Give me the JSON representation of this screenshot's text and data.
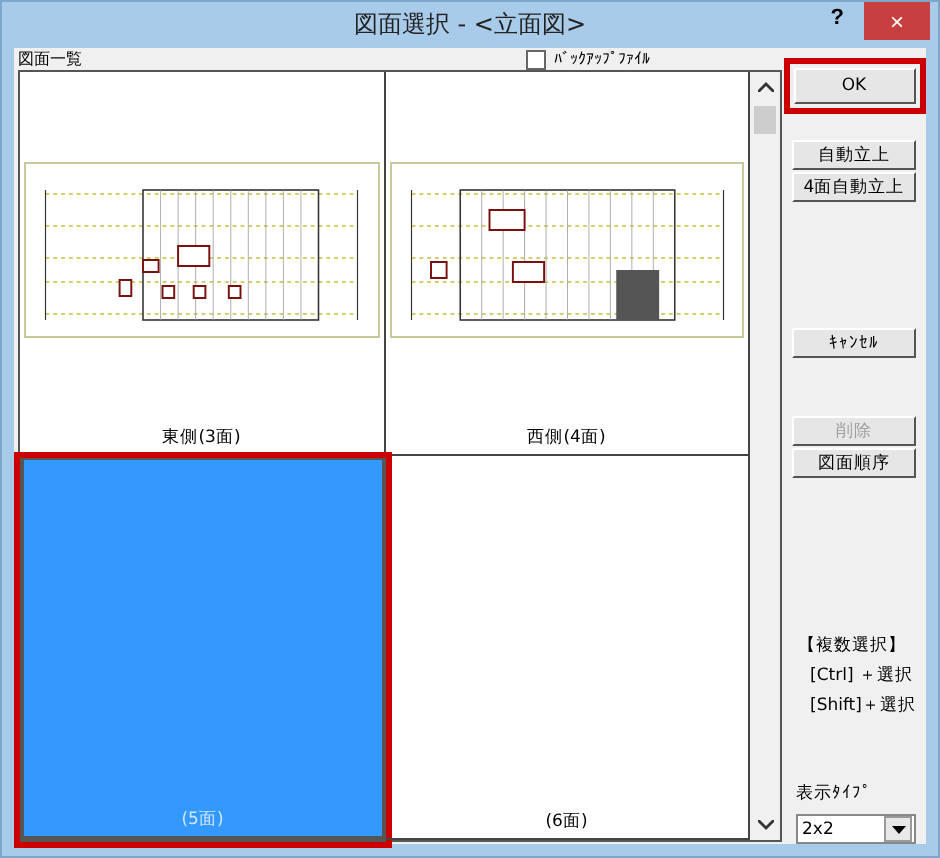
{
  "window": {
    "title": "図面選択 - <立面図>",
    "help": "?",
    "close": "×"
  },
  "list_label": "図面一覧",
  "backup_checkbox": {
    "label": "ﾊﾞｯｸｱｯﾌﾟﾌｧｲﾙ",
    "checked": false
  },
  "cells": [
    {
      "caption": "東側(3面)",
      "kind": "elevation",
      "selected": false
    },
    {
      "caption": "西側(4面)",
      "kind": "elevation",
      "selected": false
    },
    {
      "caption": "(5面)",
      "kind": "empty",
      "selected": true
    },
    {
      "caption": "(6面)",
      "kind": "empty",
      "selected": false
    }
  ],
  "button_groups": [
    [
      {
        "label": "OK",
        "disabled": false,
        "highlighted": true
      }
    ],
    [
      {
        "label": "自動立上",
        "disabled": false,
        "highlighted": false
      },
      {
        "label": "4面自動立上",
        "disabled": false,
        "highlighted": false
      }
    ],
    [
      {
        "label": "ｷｬﾝｾﾙ",
        "disabled": false,
        "highlighted": false
      }
    ],
    [
      {
        "label": "削除",
        "disabled": true,
        "highlighted": false
      },
      {
        "label": "図面順序",
        "disabled": false,
        "highlighted": false
      }
    ]
  ],
  "multi_select": {
    "heading": "【複数選択】",
    "lines": [
      "[Ctrl] ＋選択",
      "[Shift]＋選択"
    ]
  },
  "display_type": {
    "label": "表示ﾀｲﾌﾟ",
    "value": "2x2"
  }
}
